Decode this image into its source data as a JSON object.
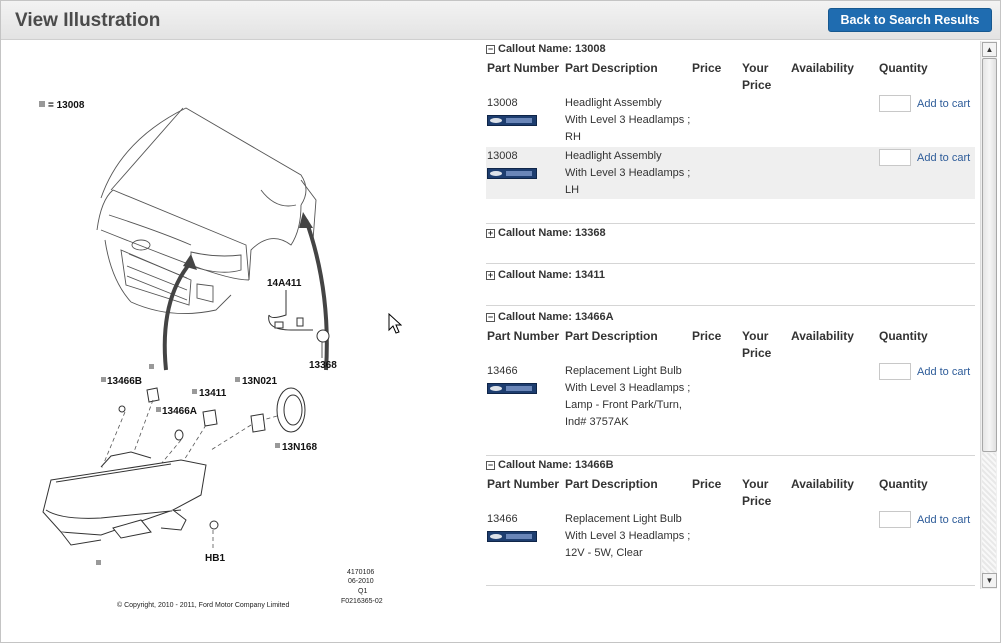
{
  "header": {
    "title": "View Illustration",
    "back_label": "Back to Search Results"
  },
  "illustration": {
    "legend": "= 13008",
    "labels": [
      "14A411",
      "13368",
      "13466B",
      "13411",
      "13N021",
      "13466A",
      "13N168",
      "HB1"
    ],
    "doc_lines": [
      "4170106",
      "06-2010",
      "Q1",
      "F0216365-02"
    ],
    "copyright": "© Copyright, 2010 - 2011, Ford Motor Company Limited"
  },
  "columns": {
    "part_number": "Part Number",
    "description": "Part Description",
    "price": "Price",
    "your_price_1": "Your",
    "your_price_2": "Price",
    "availability": "Availability",
    "quantity": "Quantity"
  },
  "add_to_cart_label": "Add to cart",
  "callouts": [
    {
      "name": "Callout Name: 13008",
      "expanded": true,
      "rows": [
        {
          "part_number": "13008",
          "desc": [
            "Headlight Assembly",
            "With Level 3 Headlamps ;",
            "RH"
          ]
        },
        {
          "part_number": "13008",
          "desc": [
            "Headlight Assembly",
            "With Level 3 Headlamps ;",
            "LH"
          ]
        }
      ]
    },
    {
      "name": "Callout Name: 13368",
      "expanded": false,
      "rows": []
    },
    {
      "name": "Callout Name: 13411",
      "expanded": false,
      "rows": []
    },
    {
      "name": "Callout Name: 13466A",
      "expanded": true,
      "rows": [
        {
          "part_number": "13466",
          "desc": [
            "Replacement Light Bulb",
            "With Level 3 Headlamps ;",
            "Lamp - Front Park/Turn,",
            "Ind# 3757AK"
          ]
        }
      ]
    },
    {
      "name": "Callout Name: 13466B",
      "expanded": true,
      "rows": [
        {
          "part_number": "13466",
          "desc": [
            "Replacement Light Bulb",
            "With Level 3 Headlamps ;",
            "12V - 5W, Clear"
          ]
        }
      ]
    }
  ]
}
